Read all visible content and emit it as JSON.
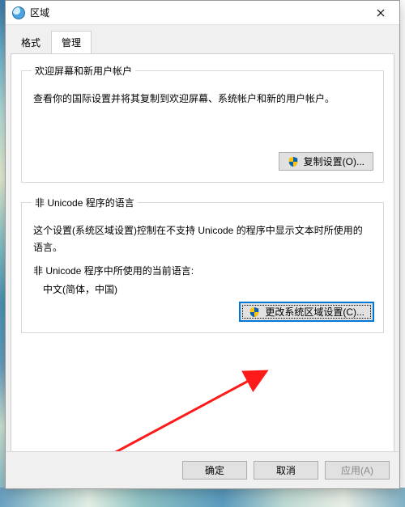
{
  "titlebar": {
    "title": "区域"
  },
  "tabs": {
    "format": "格式",
    "admin": "管理"
  },
  "group_welcome": {
    "legend": "欢迎屏幕和新用户帐户",
    "desc": "查看你的国际设置并将其复制到欢迎屏幕、系统帐户和新的用户帐户。",
    "copy_btn": "复制设置(O)..."
  },
  "group_nonunicode": {
    "legend": "非 Unicode 程序的语言",
    "desc": "这个设置(系统区域设置)控制在不支持 Unicode 的程序中显示文本时所使用的语言。",
    "current_label": "非 Unicode 程序中所使用的当前语言:",
    "current_value": "中文(简体，中国)",
    "change_btn": "更改系统区域设置(C)..."
  },
  "footer": {
    "ok": "确定",
    "cancel": "取消",
    "apply": "应用(A)"
  }
}
